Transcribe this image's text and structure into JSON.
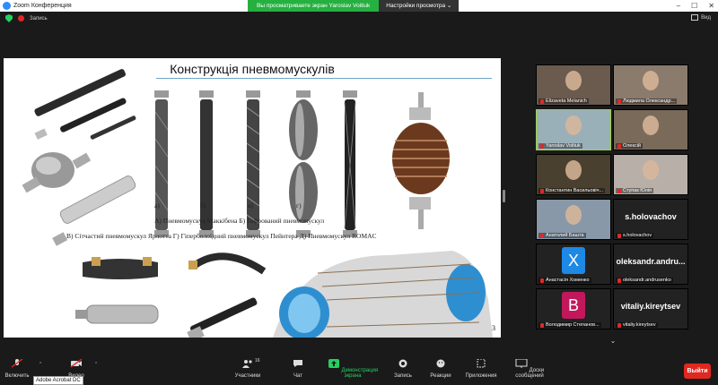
{
  "window": {
    "title": "Zoom Конференция"
  },
  "share_banner": {
    "message": "Вы просматриваете экран Yaroslav Voitiuk",
    "options": "Настройки просмотра"
  },
  "recording": {
    "label": "Запись"
  },
  "view": {
    "label": "Вид"
  },
  "slide": {
    "title": "Конструкція пневмомускулів",
    "letters": [
      "а)",
      "б)",
      "в)",
      "г)",
      "д)"
    ],
    "caption1": "А) Пневмомускул Маккібена   Б) Гофрований пневмомускул",
    "caption2": "В) Сітчастий пневмомускул Ярлотта   Г) Гіперболоїдний пневмомускул Пейнтера   Д) Пневмомускул ROMAC",
    "page": "3"
  },
  "participants": [
    {
      "name": "Elizaveta Melanich",
      "type": "video",
      "bg": "#6b5a4e"
    },
    {
      "name": "Людмила Олександр...",
      "type": "video",
      "bg": "#8a7b6c"
    },
    {
      "name": "Yaroslav Voitiuk",
      "type": "video",
      "bg": "#9ab0b8",
      "active": true
    },
    {
      "name": "Олексій",
      "type": "video",
      "bg": "#7a6a5a"
    },
    {
      "name": "Константин Васильовіч...",
      "type": "video",
      "bg": "#4a4030"
    },
    {
      "name": "Ступак Юлія",
      "type": "video",
      "bg": "#b8b0a8"
    },
    {
      "name": "Анатолий Башта",
      "type": "video",
      "bg": "#8898a8"
    },
    {
      "name": "s.holovachov",
      "type": "name",
      "display": "s.holovachov"
    },
    {
      "name": "Анастасія Хоменко",
      "type": "avatar",
      "letter": "X",
      "color": "#1e88e5"
    },
    {
      "name": "oleksandr.andrusenko",
      "type": "name",
      "display": "oleksandr.andru..."
    },
    {
      "name": "Володимир Степанов...",
      "type": "avatar",
      "letter": "B",
      "color": "#c2185b"
    },
    {
      "name": "vitaliy.kireytsev",
      "type": "name",
      "display": "vitaliy.kireytsev"
    }
  ],
  "toolbar": {
    "mute": "Включить",
    "video": "Видео",
    "tooltip": "Adobe Acrobat DC",
    "participants": "Участники",
    "participants_count": "16",
    "chat": "Чат",
    "share": "Демонстрация экрана",
    "record": "Запись",
    "reactions": "Реакции",
    "apps": "Приложения",
    "whiteboard": "Доски сообщений",
    "leave": "Выйти"
  }
}
